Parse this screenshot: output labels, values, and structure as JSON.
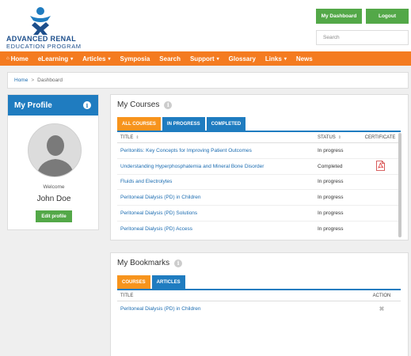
{
  "header": {
    "logo_line1": "ADVANCED RENAL",
    "logo_line2": "EDUCATION PROGRAM",
    "dashboard_button": "My Dashboard",
    "logout_button": "Logout",
    "search_placeholder": "Search"
  },
  "nav": {
    "items": [
      {
        "label": "Home",
        "icon": "home-icon"
      },
      {
        "label": "eLearning",
        "dropdown": true
      },
      {
        "label": "Articles",
        "dropdown": true
      },
      {
        "label": "Symposia"
      },
      {
        "label": "Search"
      },
      {
        "label": "Support",
        "dropdown": true
      },
      {
        "label": "Glossary"
      },
      {
        "label": "Links",
        "dropdown": true
      },
      {
        "label": "News"
      }
    ],
    "caret": "▾",
    "bar_color": "#f47b20"
  },
  "breadcrumb": {
    "home": "Home",
    "separator": ">",
    "current": "Dashboard"
  },
  "profile": {
    "title": "My Profile",
    "welcome": "Welcome",
    "name": "John Doe",
    "edit_button": "Edit profile",
    "info_glyph": "i"
  },
  "courses": {
    "title": "My Courses",
    "tabs": [
      {
        "label": "ALL COURSES",
        "active": true
      },
      {
        "label": "IN PROGRESS",
        "active": false
      },
      {
        "label": "COMPLETED",
        "active": false
      }
    ],
    "columns": {
      "title": "TITLE",
      "status": "STATUS",
      "certificate": "CERTIFICATE",
      "sort_glyph": "⇕"
    },
    "rows": [
      {
        "title": "Peritonitis: Key Concepts for Improving Patient Outcomes",
        "status": "In progress",
        "certificate": false
      },
      {
        "title": "Understanding Hyperphosphatemia and Mineral Bone Disorder",
        "status": "Completed",
        "certificate": true
      },
      {
        "title": "Fluids and Electrolytes",
        "status": "In progress",
        "certificate": false
      },
      {
        "title": "Peritoneal Dialysis (PD) in Children",
        "status": "In progress",
        "certificate": false
      },
      {
        "title": "Peritoneal Dialysis (PD) Solutions",
        "status": "In progress",
        "certificate": false
      },
      {
        "title": "Peritoneal Dialysis (PD) Access",
        "status": "In progress",
        "certificate": false
      }
    ]
  },
  "bookmarks": {
    "title": "My Bookmarks",
    "tabs": [
      {
        "label": "COURSES",
        "active": true
      },
      {
        "label": "ARTICLES",
        "active": false
      }
    ],
    "columns": {
      "title": "TITLE",
      "action": "ACTION"
    },
    "rows": [
      {
        "title": "Peritoneal Dialysis (PD) in Children",
        "action_icon": "✖"
      }
    ]
  },
  "colors": {
    "orange": "#f47b20",
    "blue": "#1f7cc0",
    "green": "#53a848",
    "link": "#1b6cb1"
  }
}
